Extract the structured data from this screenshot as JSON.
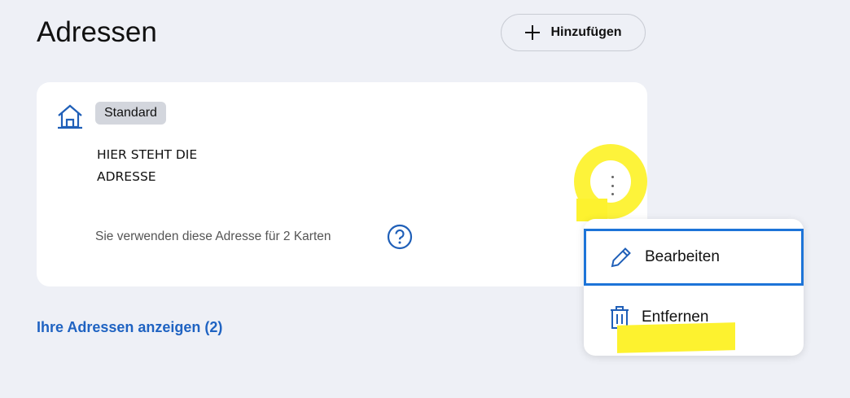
{
  "page": {
    "title": "Adressen",
    "add_button": "Hinzufügen"
  },
  "card": {
    "badge": "Standard",
    "address_line1": "HIER STEHT DIE",
    "address_line2": "ADRESSE",
    "usage_note": "Sie verwenden diese Adresse für 2 Karten"
  },
  "link": "Ihre Adressen anzeigen (2)",
  "menu": {
    "items": [
      {
        "label": "Bearbeiten",
        "icon": "pencil-icon"
      },
      {
        "label": "Entfernen",
        "icon": "trash-icon"
      }
    ]
  },
  "colors": {
    "accent": "#1f63c2",
    "highlight": "#fdf22f",
    "background": "#eef0f6"
  }
}
